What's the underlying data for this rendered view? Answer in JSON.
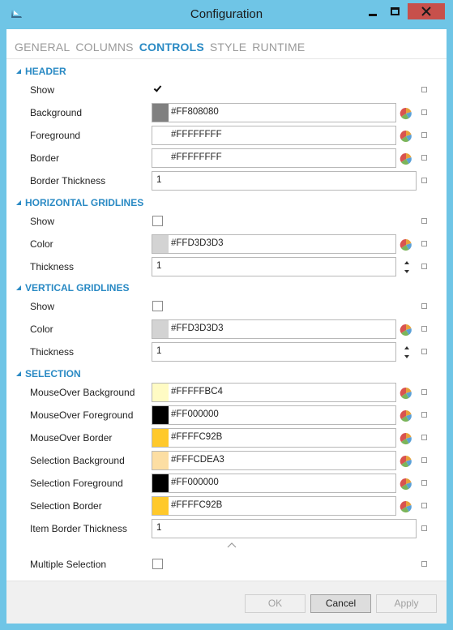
{
  "window": {
    "title": "Configuration"
  },
  "tabs": [
    "GENERAL",
    "COLUMNS",
    "CONTROLS",
    "STYLE",
    "RUNTIME"
  ],
  "active_tab": "CONTROLS",
  "sections": {
    "header": {
      "title": "HEADER",
      "show": {
        "label": "Show",
        "checked": true
      },
      "background": {
        "label": "Background",
        "value": "#FF808080",
        "swatch": "#808080"
      },
      "foreground": {
        "label": "Foreground",
        "value": "#FFFFFFFF",
        "swatch": "#FFFFFF"
      },
      "border": {
        "label": "Border",
        "value": "#FFFFFFFF",
        "swatch": "#FFFFFF"
      },
      "border_thickness": {
        "label": "Border Thickness",
        "value": "1"
      }
    },
    "horizontal_gridlines": {
      "title": "HORIZONTAL GRIDLINES",
      "show": {
        "label": "Show",
        "checked": false
      },
      "color": {
        "label": "Color",
        "value": "#FFD3D3D3",
        "swatch": "#D3D3D3"
      },
      "thickness": {
        "label": "Thickness",
        "value": "1"
      }
    },
    "vertical_gridlines": {
      "title": "VERTICAL GRIDLINES",
      "show": {
        "label": "Show",
        "checked": false
      },
      "color": {
        "label": "Color",
        "value": "#FFD3D3D3",
        "swatch": "#D3D3D3"
      },
      "thickness": {
        "label": "Thickness",
        "value": "1"
      }
    },
    "selection": {
      "title": "SELECTION",
      "mouseover_background": {
        "label": "MouseOver Background",
        "value": "#FFFFFBC4",
        "swatch": "#FFFBC4"
      },
      "mouseover_foreground": {
        "label": "MouseOver Foreground",
        "value": "#FF000000",
        "swatch": "#000000"
      },
      "mouseover_border": {
        "label": "MouseOver Border",
        "value": "#FFFFC92B",
        "swatch": "#FFC92B"
      },
      "selection_background": {
        "label": "Selection Background",
        "value": "#FFFCDEA3",
        "swatch": "#FCDEA3"
      },
      "selection_foreground": {
        "label": "Selection Foreground",
        "value": "#FF000000",
        "swatch": "#000000"
      },
      "selection_border": {
        "label": "Selection Border",
        "value": "#FFFFC92B",
        "swatch": "#FFC92B"
      },
      "item_border_thickness": {
        "label": "Item Border Thickness",
        "value": "1"
      },
      "multiple_selection": {
        "label": "Multiple Selection",
        "checked": false
      }
    }
  },
  "footer": {
    "ok": "OK",
    "cancel": "Cancel",
    "apply": "Apply"
  },
  "icons": {
    "picker": "color-wheel-icon",
    "reset": "reset-square-icon",
    "spin": "spin-arrows-icon",
    "collapse": "chevron-up-icon",
    "app": "app-icon"
  },
  "colors": {
    "accent": "#2a8ac4",
    "titlebar": "#6fc5e6",
    "close": "#c7504b"
  }
}
